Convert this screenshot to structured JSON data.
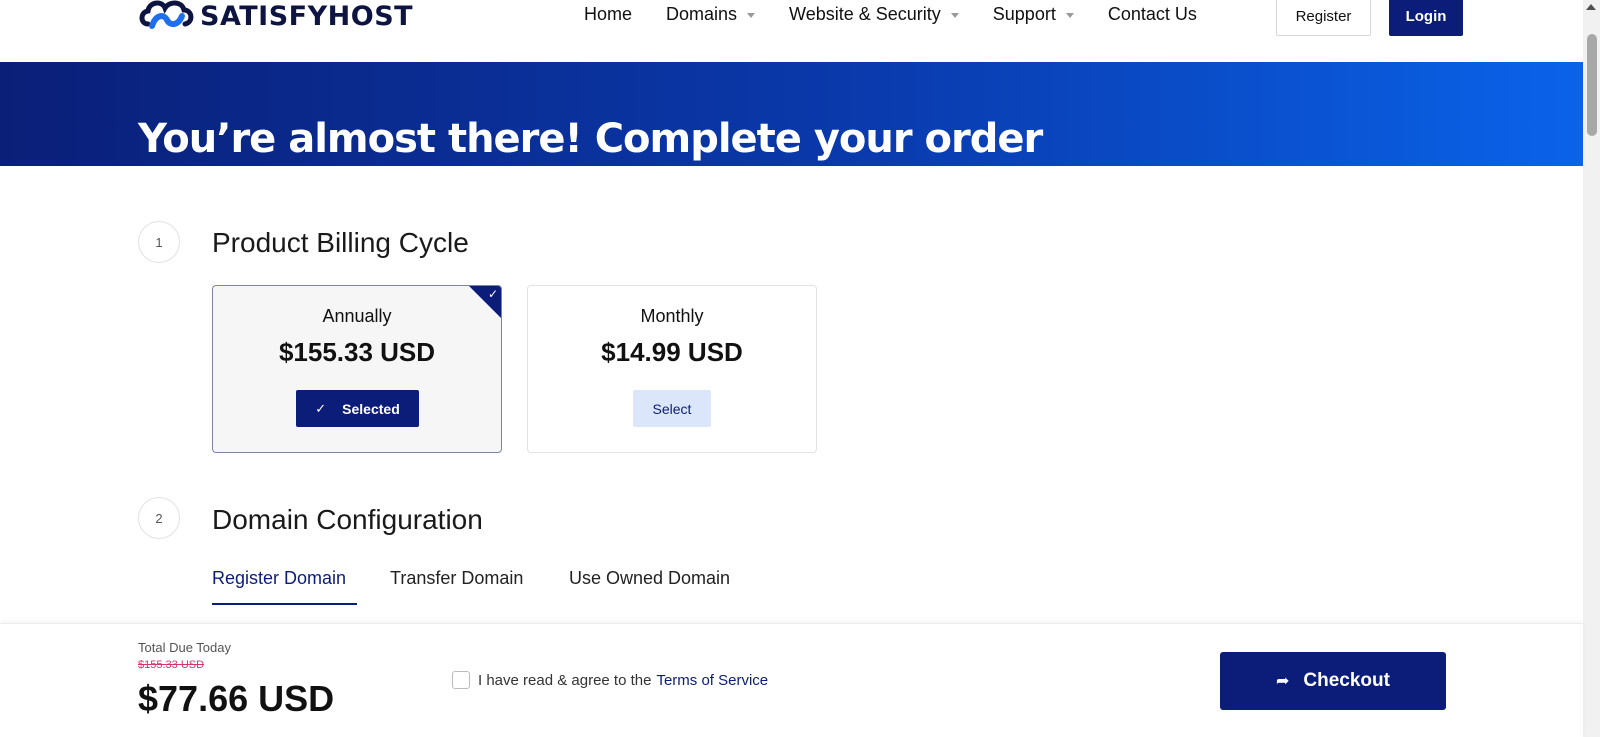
{
  "header": {
    "logo_text": "SATISFYHOST",
    "nav": [
      {
        "label": "Home",
        "has_dropdown": false
      },
      {
        "label": "Domains",
        "has_dropdown": true
      },
      {
        "label": "Website & Security",
        "has_dropdown": true
      },
      {
        "label": "Support",
        "has_dropdown": true
      },
      {
        "label": "Contact Us",
        "has_dropdown": false
      }
    ],
    "register_label": "Register",
    "login_label": "Login"
  },
  "banner": {
    "title": "You’re almost there! Complete your order"
  },
  "steps": [
    {
      "number": "1",
      "title": "Product Billing Cycle"
    },
    {
      "number": "2",
      "title": "Domain Configuration"
    }
  ],
  "billing": {
    "options": [
      {
        "label": "Annually",
        "price": "$155.33 USD",
        "button": "Selected",
        "selected": true
      },
      {
        "label": "Monthly",
        "price": "$14.99 USD",
        "button": "Select",
        "selected": false
      }
    ]
  },
  "domain_tabs": [
    {
      "label": "Register Domain",
      "active": true
    },
    {
      "label": "Transfer Domain",
      "active": false
    },
    {
      "label": "Use Owned Domain",
      "active": false
    }
  ],
  "footer_bar": {
    "total_label": "Total Due Today",
    "old_price": "$155.33 USD",
    "total_amount": "$77.66 USD",
    "terms_text": "I have read & agree to the",
    "terms_link": "Terms of Service",
    "checkout_label": "Checkout"
  },
  "icons": {
    "logo": "cloud-infinity-icon",
    "check": "check-icon",
    "checkout": "share-arrow-icon"
  },
  "colors": {
    "brand": "#0b1d78",
    "banner_start": "#0a1f78",
    "banner_end": "#0a63ea",
    "select_bg": "#dbe6fb",
    "old_price": "#d4366b"
  }
}
